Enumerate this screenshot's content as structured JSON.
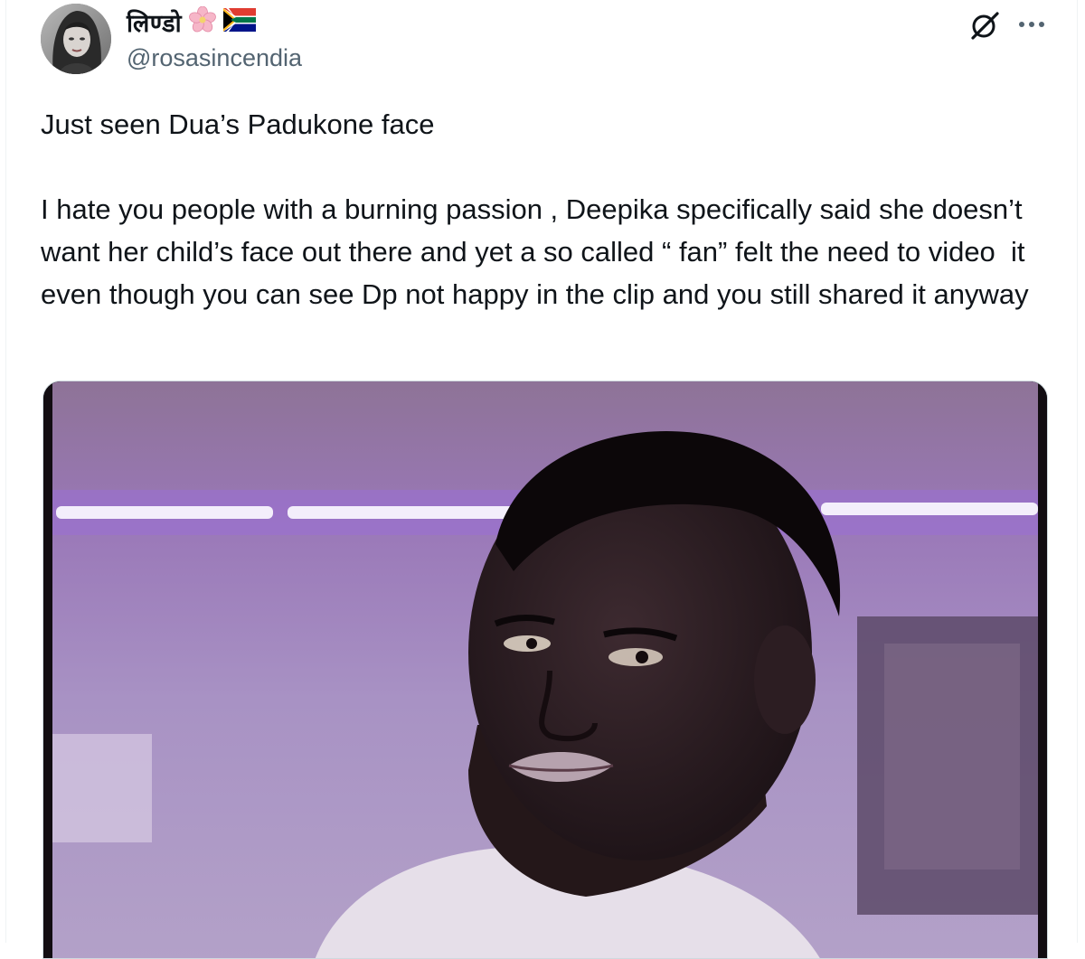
{
  "author": {
    "display_name": "लिण्डो",
    "emoji_flower": "🌸",
    "flag_icon": "south-africa-flag-icon",
    "handle": "@rosasincendia"
  },
  "actions": {
    "grok_icon": "grok-icon",
    "more_icon": "more-icon"
  },
  "tweet": {
    "text": "Just seen Dua’s Padukone face\n\nI hate you people with a burning passion , Deepika specifically said she doesn’t want her child’s face out there and yet a so called “ fan” felt the need to video  it even though you can see Dp not happy in the clip and you still shared it anyway"
  },
  "colors": {
    "text_primary": "#0f1419",
    "text_secondary": "#536471",
    "border": "#cfd9de",
    "media_tint": "#8f6fa8"
  }
}
